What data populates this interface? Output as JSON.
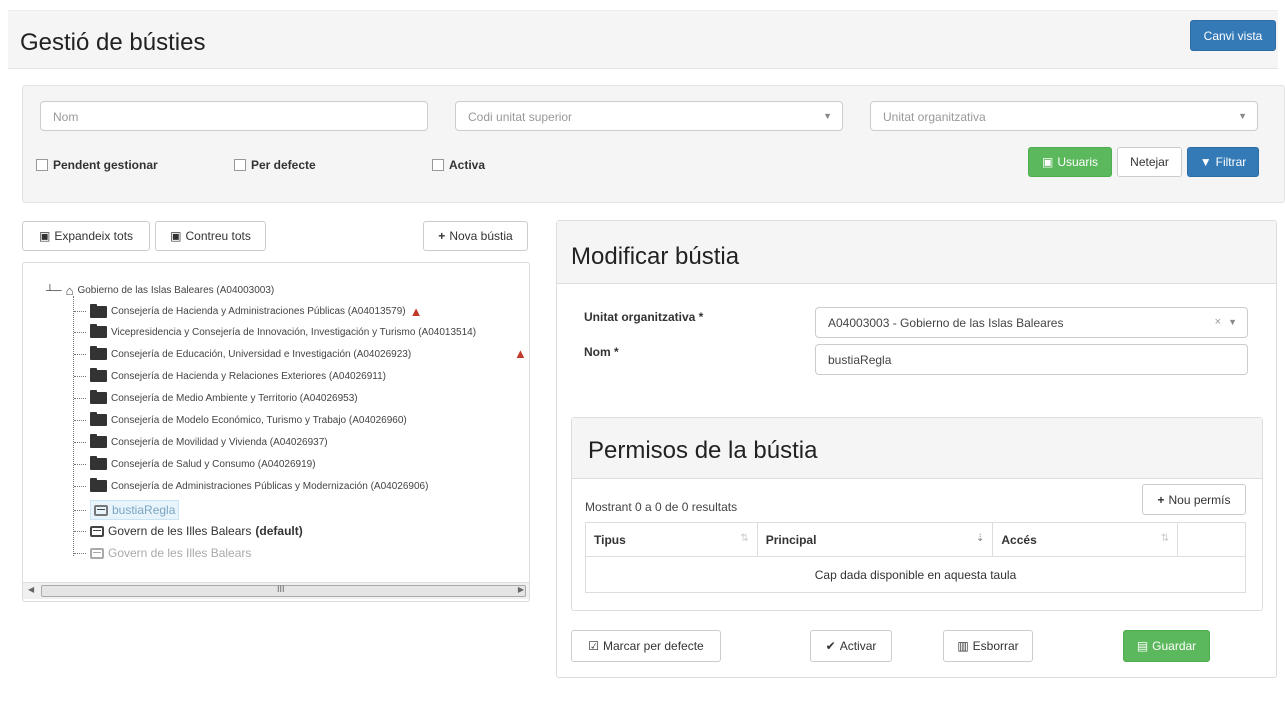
{
  "header": {
    "title": "Gestió de bústies",
    "change_view": "Canvi vista"
  },
  "filters": {
    "nom_placeholder": "Nom",
    "codi_placeholder": "Codi unitat superior",
    "unitat_placeholder": "Unitat organitzativa",
    "pendent": "Pendent gestionar",
    "per_defecte": "Per defecte",
    "activa": "Activa",
    "usuaris": "Usuaris",
    "netejar": "Netejar",
    "filtrar": "Filtrar"
  },
  "tree_toolbar": {
    "expand": "Expandeix tots",
    "collapse": "Contreu tots",
    "new": "Nova bústia"
  },
  "tree": {
    "root": "Gobierno de las Islas Baleares (A04003003)",
    "folders": [
      "Consejería de Hacienda y Administraciones Públicas (A04013579)",
      "Vicepresidencia y Consejería de Innovación, Investigación y Turismo (A04013514)",
      "Consejería de Educación, Universidad e Investigación (A04026923)",
      "Consejería de Hacienda y Relaciones Exteriores (A04026911)",
      "Consejería de Medio Ambiente y Territorio (A04026953)",
      "Consejería de Modelo Económico, Turismo y Trabajo (A04026960)",
      "Consejería de Movilidad y Vivienda (A04026937)",
      "Consejería de Salud y Consumo (A04026919)",
      "Consejería de Administraciones Públicas y Modernización (A04026906)"
    ],
    "boxes": [
      {
        "label": "bustiaRegla",
        "suffix": ""
      },
      {
        "label": "Govern de les Illes Balears",
        "suffix": "(default)"
      },
      {
        "label": "Govern de les Illes Balears",
        "suffix": ""
      }
    ],
    "scroll_glyph": "III"
  },
  "form": {
    "title": "Modificar bústia",
    "unitat_label": "Unitat organitzativa *",
    "unitat_value": "A04003003 - Gobierno de las Islas Baleares",
    "nom_label": "Nom *",
    "nom_value": "bustiaRegla"
  },
  "permisos": {
    "title": "Permisos de la bústia",
    "info": "Mostrant 0 a 0 de 0 resultats",
    "new": "Nou permís",
    "columns": [
      "Tipus",
      "Principal",
      "Accés"
    ],
    "empty": "Cap dada disponible en aquesta taula"
  },
  "actions": {
    "default": "Marcar per defecte",
    "activate": "Activar",
    "delete": "Esborrar",
    "save": "Guardar"
  }
}
